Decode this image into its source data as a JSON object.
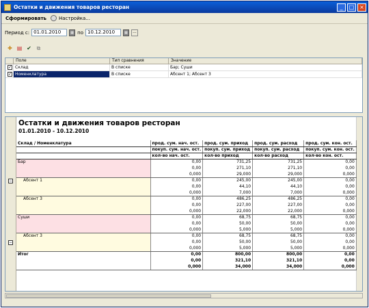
{
  "window": {
    "title": "Остатки и движения товаров ресторан"
  },
  "toolbar": {
    "form_label": "Сформировать",
    "settings_label": "Настройка..."
  },
  "period": {
    "label_from": "Период с:",
    "from": "01.01.2010",
    "label_to": "по",
    "to": "10.12.2010"
  },
  "filters": {
    "columns": [
      "Поле",
      "Тип сравнения",
      "Значение"
    ],
    "rows": [
      {
        "field": "Склад",
        "comparison": "В списке",
        "value": "Бар; Суши"
      },
      {
        "field": "Номенклатура",
        "comparison": "В списке",
        "value": "Абсент 1; Абсент 3"
      }
    ]
  },
  "report": {
    "title": "Остатки и движения товаров ресторан",
    "period": "01.01.2010 - 10.12.2010",
    "group_header": "Склад / Номенклатура",
    "col_headers": [
      [
        "прод. сум. нач. ост.",
        "прод. сум. приход",
        "прод. сум. расход",
        "прод. сум. кон. ост."
      ],
      [
        "покуп. сум. нач. ост.",
        "покуп. сум. приход",
        "покуп. сум. расход",
        "покуп. сум. кон. ост."
      ],
      [
        "кол-во нач. ост.",
        "кол-во приход",
        "кол-во расход",
        "кол-во кон. ост."
      ]
    ],
    "rows": [
      {
        "name": "Бар",
        "cls": "pink",
        "vals": [
          [
            "0,00",
            "731,25",
            "731,25",
            "0,00"
          ],
          [
            "0,00",
            "271,10",
            "271,10",
            "0,00"
          ],
          [
            "0,000",
            "29,000",
            "29,000",
            "0,000"
          ]
        ]
      },
      {
        "name": "Абсент 1",
        "cls": "yel",
        "indent": true,
        "vals": [
          [
            "0,00",
            "245,00",
            "245,00",
            "0,00"
          ],
          [
            "0,00",
            "44,10",
            "44,10",
            "0,00"
          ],
          [
            "0,000",
            "7,000",
            "7,000",
            "0,000"
          ]
        ]
      },
      {
        "name": "Абсент 3",
        "cls": "yel",
        "indent": true,
        "vals": [
          [
            "0,00",
            "486,25",
            "486,25",
            "0,00"
          ],
          [
            "0,00",
            "227,00",
            "227,00",
            "0,00"
          ],
          [
            "0,000",
            "22,000",
            "22,000",
            "0,000"
          ]
        ]
      },
      {
        "name": "Суши",
        "cls": "pink",
        "vals": [
          [
            "0,00",
            "68,75",
            "68,75",
            "0,00"
          ],
          [
            "0,00",
            "50,00",
            "50,00",
            "0,00"
          ],
          [
            "0,000",
            "5,000",
            "5,000",
            "0,000"
          ]
        ]
      },
      {
        "name": "Абсент 3",
        "cls": "yel",
        "indent": true,
        "vals": [
          [
            "0,00",
            "68,75",
            "68,75",
            "0,00"
          ],
          [
            "0,00",
            "50,00",
            "50,00",
            "0,00"
          ],
          [
            "0,000",
            "5,000",
            "5,000",
            "0,000"
          ]
        ]
      },
      {
        "name": "Итог",
        "cls": "tot",
        "vals": [
          [
            "0,00",
            "800,00",
            "800,00",
            "0,00"
          ],
          [
            "0,00",
            "321,10",
            "321,10",
            "0,00"
          ],
          [
            "0,000",
            "34,000",
            "34,000",
            "0,000"
          ]
        ]
      }
    ]
  }
}
